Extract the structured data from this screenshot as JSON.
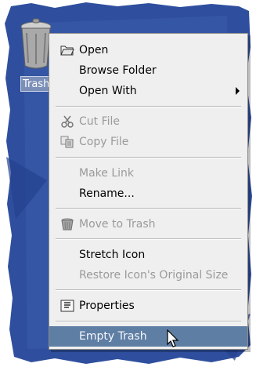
{
  "desktop": {
    "icon_label": "Trash",
    "desktop_color": "#2f4f9e"
  },
  "menu": {
    "items": [
      {
        "id": "open",
        "label": "Open",
        "mnemonic": "O",
        "icon": "folder-icon",
        "enabled": true
      },
      {
        "id": "browse-folder",
        "label": "Browse Folder",
        "enabled": true
      },
      {
        "id": "open-with",
        "label": "Open With",
        "mnemonic": "h",
        "enabled": true,
        "submenu": true
      },
      {
        "id": "cut-file",
        "label": "Cut File",
        "mnemonic": "t",
        "icon": "scissors-icon",
        "enabled": false
      },
      {
        "id": "copy-file",
        "label": "Copy File",
        "mnemonic": "C",
        "icon": "copy-icon",
        "enabled": false
      },
      {
        "id": "make-link",
        "label": "Make Link",
        "mnemonic": "k",
        "enabled": false
      },
      {
        "id": "rename",
        "label": "Rename...",
        "mnemonic": "R",
        "enabled": true
      },
      {
        "id": "move-to-trash",
        "label": "Move to Trash",
        "mnemonic": "v",
        "icon": "trash-icon",
        "enabled": false
      },
      {
        "id": "stretch-icon",
        "label": "Stretch Icon",
        "mnemonic": "e",
        "enabled": true
      },
      {
        "id": "restore-icon-size",
        "label": "Restore Icon's Original Size",
        "mnemonic": "z",
        "enabled": false
      },
      {
        "id": "properties",
        "label": "Properties",
        "mnemonic": "P",
        "icon": "properties-icon",
        "enabled": true
      },
      {
        "id": "empty-trash",
        "label": "Empty Trash",
        "enabled": true,
        "selected": true
      }
    ]
  },
  "colors": {
    "menu_bg": "#efefef",
    "selection": "#5f7ea3",
    "disabled_text": "#9a9a9a"
  }
}
